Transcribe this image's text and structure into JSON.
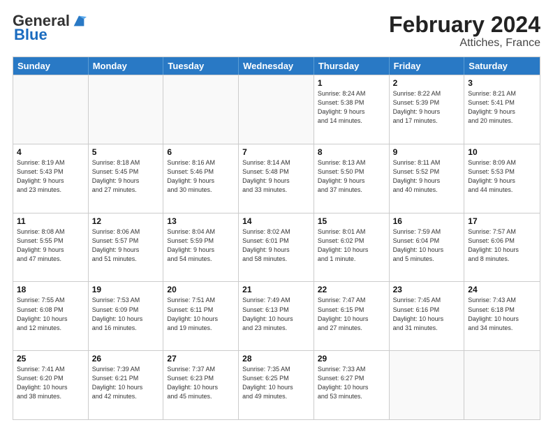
{
  "header": {
    "logo_general": "General",
    "logo_blue": "Blue",
    "month_title": "February 2024",
    "location": "Attiches, France"
  },
  "days_of_week": [
    "Sunday",
    "Monday",
    "Tuesday",
    "Wednesday",
    "Thursday",
    "Friday",
    "Saturday"
  ],
  "weeks": [
    [
      {
        "day": "",
        "info": "",
        "empty": true
      },
      {
        "day": "",
        "info": "",
        "empty": true
      },
      {
        "day": "",
        "info": "",
        "empty": true
      },
      {
        "day": "",
        "info": "",
        "empty": true
      },
      {
        "day": "1",
        "info": "Sunrise: 8:24 AM\nSunset: 5:38 PM\nDaylight: 9 hours\nand 14 minutes."
      },
      {
        "day": "2",
        "info": "Sunrise: 8:22 AM\nSunset: 5:39 PM\nDaylight: 9 hours\nand 17 minutes."
      },
      {
        "day": "3",
        "info": "Sunrise: 8:21 AM\nSunset: 5:41 PM\nDaylight: 9 hours\nand 20 minutes."
      }
    ],
    [
      {
        "day": "4",
        "info": "Sunrise: 8:19 AM\nSunset: 5:43 PM\nDaylight: 9 hours\nand 23 minutes."
      },
      {
        "day": "5",
        "info": "Sunrise: 8:18 AM\nSunset: 5:45 PM\nDaylight: 9 hours\nand 27 minutes."
      },
      {
        "day": "6",
        "info": "Sunrise: 8:16 AM\nSunset: 5:46 PM\nDaylight: 9 hours\nand 30 minutes."
      },
      {
        "day": "7",
        "info": "Sunrise: 8:14 AM\nSunset: 5:48 PM\nDaylight: 9 hours\nand 33 minutes."
      },
      {
        "day": "8",
        "info": "Sunrise: 8:13 AM\nSunset: 5:50 PM\nDaylight: 9 hours\nand 37 minutes."
      },
      {
        "day": "9",
        "info": "Sunrise: 8:11 AM\nSunset: 5:52 PM\nDaylight: 9 hours\nand 40 minutes."
      },
      {
        "day": "10",
        "info": "Sunrise: 8:09 AM\nSunset: 5:53 PM\nDaylight: 9 hours\nand 44 minutes."
      }
    ],
    [
      {
        "day": "11",
        "info": "Sunrise: 8:08 AM\nSunset: 5:55 PM\nDaylight: 9 hours\nand 47 minutes."
      },
      {
        "day": "12",
        "info": "Sunrise: 8:06 AM\nSunset: 5:57 PM\nDaylight: 9 hours\nand 51 minutes."
      },
      {
        "day": "13",
        "info": "Sunrise: 8:04 AM\nSunset: 5:59 PM\nDaylight: 9 hours\nand 54 minutes."
      },
      {
        "day": "14",
        "info": "Sunrise: 8:02 AM\nSunset: 6:01 PM\nDaylight: 9 hours\nand 58 minutes."
      },
      {
        "day": "15",
        "info": "Sunrise: 8:01 AM\nSunset: 6:02 PM\nDaylight: 10 hours\nand 1 minute."
      },
      {
        "day": "16",
        "info": "Sunrise: 7:59 AM\nSunset: 6:04 PM\nDaylight: 10 hours\nand 5 minutes."
      },
      {
        "day": "17",
        "info": "Sunrise: 7:57 AM\nSunset: 6:06 PM\nDaylight: 10 hours\nand 8 minutes."
      }
    ],
    [
      {
        "day": "18",
        "info": "Sunrise: 7:55 AM\nSunset: 6:08 PM\nDaylight: 10 hours\nand 12 minutes."
      },
      {
        "day": "19",
        "info": "Sunrise: 7:53 AM\nSunset: 6:09 PM\nDaylight: 10 hours\nand 16 minutes."
      },
      {
        "day": "20",
        "info": "Sunrise: 7:51 AM\nSunset: 6:11 PM\nDaylight: 10 hours\nand 19 minutes."
      },
      {
        "day": "21",
        "info": "Sunrise: 7:49 AM\nSunset: 6:13 PM\nDaylight: 10 hours\nand 23 minutes."
      },
      {
        "day": "22",
        "info": "Sunrise: 7:47 AM\nSunset: 6:15 PM\nDaylight: 10 hours\nand 27 minutes."
      },
      {
        "day": "23",
        "info": "Sunrise: 7:45 AM\nSunset: 6:16 PM\nDaylight: 10 hours\nand 31 minutes."
      },
      {
        "day": "24",
        "info": "Sunrise: 7:43 AM\nSunset: 6:18 PM\nDaylight: 10 hours\nand 34 minutes."
      }
    ],
    [
      {
        "day": "25",
        "info": "Sunrise: 7:41 AM\nSunset: 6:20 PM\nDaylight: 10 hours\nand 38 minutes."
      },
      {
        "day": "26",
        "info": "Sunrise: 7:39 AM\nSunset: 6:21 PM\nDaylight: 10 hours\nand 42 minutes."
      },
      {
        "day": "27",
        "info": "Sunrise: 7:37 AM\nSunset: 6:23 PM\nDaylight: 10 hours\nand 45 minutes."
      },
      {
        "day": "28",
        "info": "Sunrise: 7:35 AM\nSunset: 6:25 PM\nDaylight: 10 hours\nand 49 minutes."
      },
      {
        "day": "29",
        "info": "Sunrise: 7:33 AM\nSunset: 6:27 PM\nDaylight: 10 hours\nand 53 minutes."
      },
      {
        "day": "",
        "info": "",
        "empty": true
      },
      {
        "day": "",
        "info": "",
        "empty": true
      }
    ]
  ]
}
